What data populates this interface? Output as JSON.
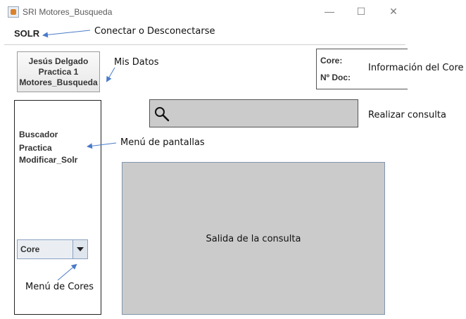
{
  "window": {
    "title": "SRI Motores_Busqueda",
    "minimize": "—",
    "maximize": "☐",
    "close": "✕"
  },
  "menubar": {
    "solr_label": "SOLR"
  },
  "user": {
    "line1": "Jesús Delgado",
    "line2": "Practica 1",
    "line3": "Motores_Busqueda"
  },
  "core_info": {
    "core_label": "Core:",
    "ndoc_label": "Nº Doc:"
  },
  "screens_menu": {
    "items": [
      "Buscador",
      "Practica",
      "Modificar_Solr"
    ]
  },
  "core_selector": {
    "selected": "Core"
  },
  "search": {
    "value": ""
  },
  "output": {
    "label": "Salida de la consulta"
  },
  "annotations": {
    "connect": "Conectar o Desconectarse",
    "my_data": "Mis Datos",
    "core_info": "Información del Core",
    "query": "Realizar consulta",
    "screens_menu": "Menú de pantallas",
    "cores_menu": "Menú de Cores"
  },
  "colors": {
    "annotation_arrow": "#4a7bc8",
    "field_gray": "#cbcbcb"
  }
}
